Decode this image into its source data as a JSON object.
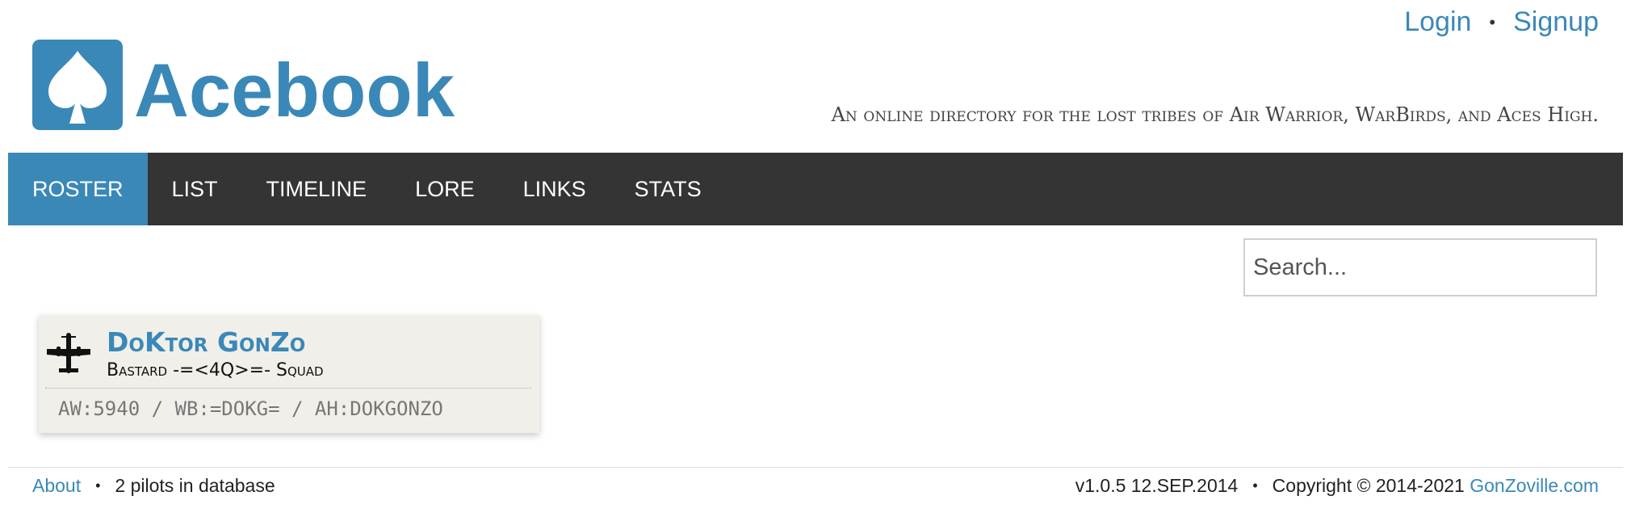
{
  "header": {
    "login": "Login",
    "signup": "Signup",
    "separator": "•",
    "brand": "Acebook",
    "tagline": "An online directory for the lost tribes of Air Warrior, WarBirds, and Aces High."
  },
  "nav": {
    "items": [
      {
        "label": "ROSTER",
        "active": true
      },
      {
        "label": "LIST",
        "active": false
      },
      {
        "label": "TIMELINE",
        "active": false
      },
      {
        "label": "LORE",
        "active": false
      },
      {
        "label": "LINKS",
        "active": false
      },
      {
        "label": "STATS",
        "active": false
      }
    ]
  },
  "search": {
    "placeholder": "Search...",
    "value": ""
  },
  "roster": [
    {
      "name": "DoKtor GonZo",
      "squad": "Bastard -=<4Q>=- Squad",
      "handles": "AW:5940 / WB:=DOKG= / AH:DOKGONZO",
      "icon": "plane-icon"
    }
  ],
  "footer": {
    "about": "About",
    "separator": "•",
    "count_text": "2 pilots in database",
    "version": "v1.0.5 12.SEP.2014",
    "copyright": "Copyright © 2014-2021",
    "site_link": "GonZoville.com"
  },
  "colors": {
    "accent": "#3a88b8",
    "nav_bg": "#343434",
    "card_bg": "#f1efe9"
  }
}
